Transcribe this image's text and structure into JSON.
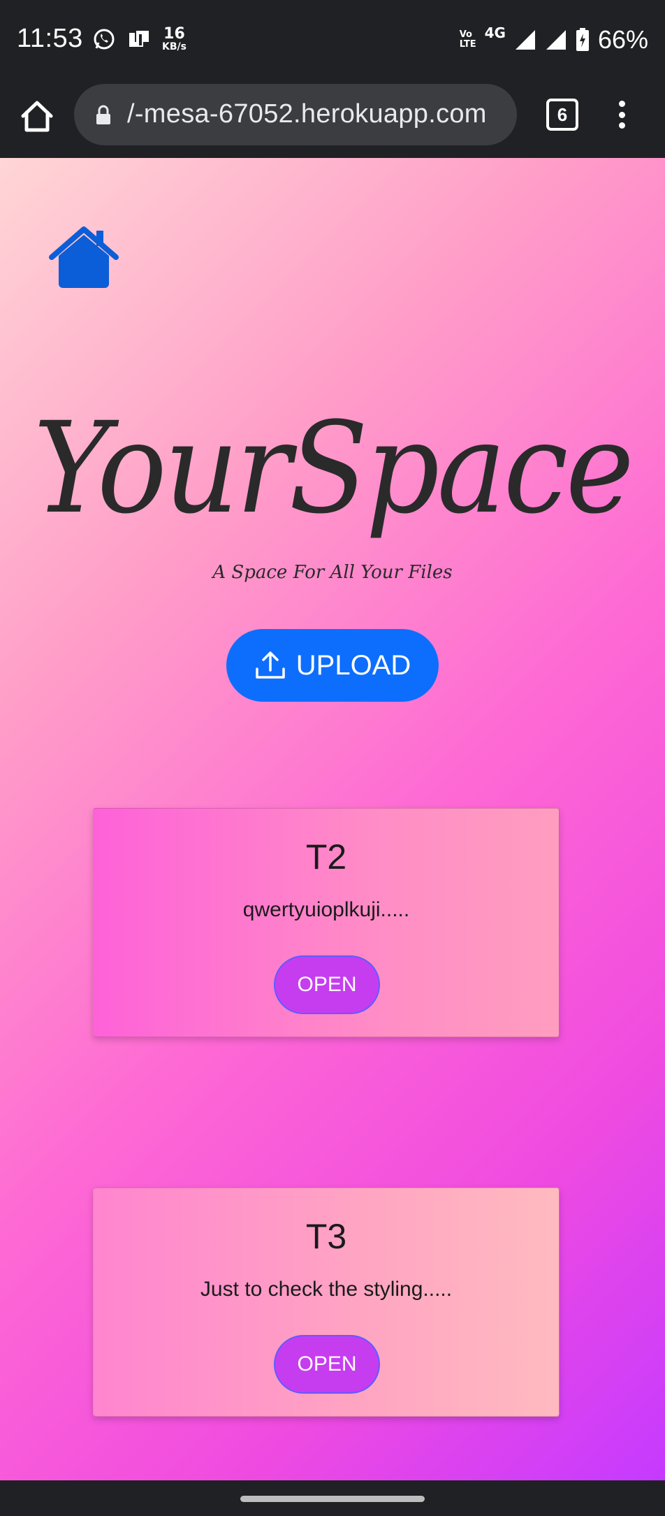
{
  "status_bar": {
    "time": "11:53",
    "speed_value": "16",
    "speed_unit": "KB/s",
    "volte_top": "Vo",
    "volte_bottom": "LTE",
    "network": "4G",
    "battery_percent": "66%"
  },
  "browser": {
    "url": "/-mesa-67052.herokuapp.com",
    "tab_count": "6"
  },
  "page": {
    "logo": "YourSpace",
    "tagline": "A Space For All Your Files",
    "upload_label": "UPLOAD",
    "cards": [
      {
        "title": "T2",
        "description": "qwertyuioplkuji.....",
        "button": "OPEN"
      },
      {
        "title": "T3",
        "description": "Just to check the styling.....",
        "button": "OPEN"
      }
    ]
  },
  "colors": {
    "accent_upload": "#0d6efd",
    "open_button": "#c63df0",
    "home_icon": "#0b5ed7"
  }
}
